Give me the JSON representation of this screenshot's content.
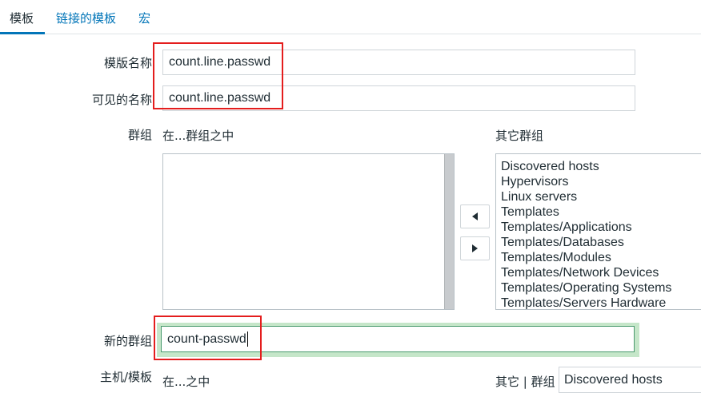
{
  "tabs": [
    {
      "label": "模板"
    },
    {
      "label": "链接的模板"
    },
    {
      "label": "宏"
    }
  ],
  "form": {
    "template_name_label": "模版名称",
    "template_name_value": "count.line.passwd",
    "visible_name_label": "可见的名称",
    "visible_name_value": "count.line.passwd",
    "groups_label": "群组",
    "in_groups_caption": "在...群组之中",
    "other_groups_caption": "其它群组",
    "other_groups": [
      "Discovered hosts",
      "Hypervisors",
      "Linux servers",
      "Templates",
      "Templates/Applications",
      "Templates/Databases",
      "Templates/Modules",
      "Templates/Network Devices",
      "Templates/Operating Systems",
      "Templates/Servers Hardware"
    ],
    "new_group_label": "新的群组",
    "new_group_value": "count-passwd",
    "hosts_templates_label": "主机/模板",
    "in_caption": "在...之中",
    "other_group_caption": "其它 | 群组",
    "other_group_select_value": "Discovered hosts"
  },
  "colors": {
    "link": "#0275b8",
    "highlight_border": "#e41d1d",
    "focus_glow": "#c5e6c9"
  },
  "icons": {
    "move_left": "triangle-left",
    "move_right": "triangle-right"
  }
}
